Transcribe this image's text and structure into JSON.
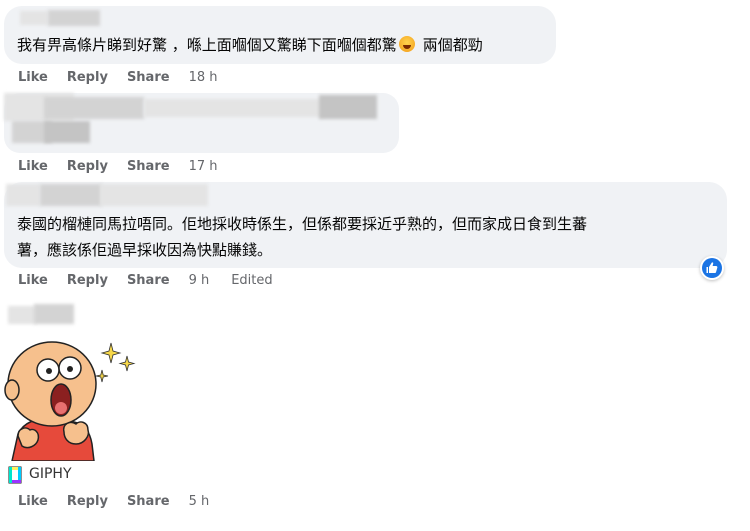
{
  "colors": {
    "bubble": "#f0f2f5",
    "action_text": "#65676b",
    "like_blue": "#1b74e4",
    "giphy_accent": "#b06cf0"
  },
  "actions": {
    "like": "Like",
    "reply": "Reply",
    "share": "Share",
    "edited": "Edited"
  },
  "comments": [
    {
      "text": "我有畀高條片睇到好驚 ，喺上面嗰個又驚睇下面嗰個都驚",
      "after_emoji": "兩個都勁",
      "emoji_icon": "rofl-emoji-icon",
      "time": "18 h"
    },
    {
      "time": "17 h"
    },
    {
      "lines": [
        "泰國的榴槤同馬拉唔同。佢地採收時係生，但係都要採近乎熟的，但而家成日食到生蕃",
        "薯，應該係佢過早採收因為快點賺錢。"
      ],
      "time": "9 h",
      "edited": "Edited",
      "reaction_icon": "thumbs-up-icon"
    },
    {
      "gif_provider": "GIPHY",
      "time": "5 h"
    }
  ]
}
